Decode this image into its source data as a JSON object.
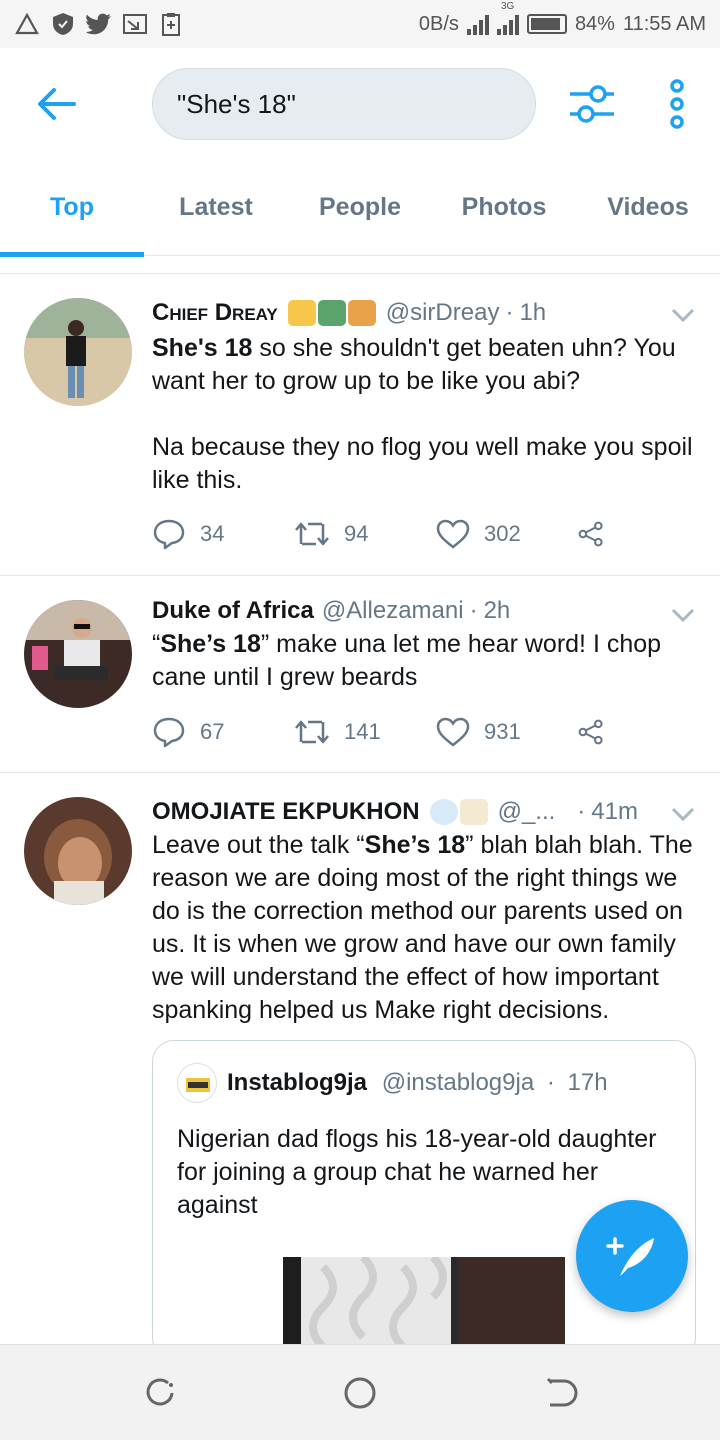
{
  "status_bar": {
    "net_speed": "0B/s",
    "network_type": "3G",
    "battery": "84%",
    "time": "11:55 AM",
    "icons": [
      "alert-triangle-icon",
      "shield-icon",
      "twitter-icon",
      "cast-icon",
      "clipboard-icon",
      "signal-icon",
      "signal-3g-icon",
      "battery-icon"
    ]
  },
  "header": {
    "search_query": "\"She's 18\"",
    "icons": [
      "back-arrow-icon",
      "filter-icon",
      "more-vertical-icon"
    ]
  },
  "tabs": [
    {
      "label": "Top",
      "active": true
    },
    {
      "label": "Latest",
      "active": false
    },
    {
      "label": "People",
      "active": false
    },
    {
      "label": "Photos",
      "active": false
    },
    {
      "label": "Videos",
      "active": false
    }
  ],
  "tweets": [
    {
      "name": "Chief Dreay",
      "handle": "@sirDreay",
      "time": "1h",
      "text_bold": "She's 18",
      "text_rest": " so she shouldn't get beaten uhn? You want her to grow up to be like you abi?",
      "text_para2": "Na because they no flog you well make you spoil like this.",
      "replies": "34",
      "retweets": "94",
      "likes": "302"
    },
    {
      "name": "Duke of Africa",
      "handle": "@Allezamani",
      "time": "2h",
      "text_open": "“",
      "text_bold": "She’s 18",
      "text_rest": "” make una let me hear word! I chop cane until I grew beards",
      "replies": "67",
      "retweets": "141",
      "likes": "931"
    },
    {
      "name": "OMOJIATE EKPUKHON",
      "handle": "@_...",
      "time": "41m",
      "text_pre": "Leave out the talk “",
      "text_bold": "She’s 18",
      "text_rest": "” blah blah blah. The reason we are doing most of the right things we do is the correction method our parents used on us. It is when we grow and have our own family we will understand the effect of how important spanking helped us Make right decisions.",
      "quoted": {
        "name": "Instablog9ja",
        "handle": "@instablog9ja",
        "time": "17h",
        "text": "Nigerian dad flogs his 18-year-old daughter for joining a group chat he warned her against"
      }
    }
  ],
  "colors": {
    "accent": "#1da1f2",
    "secondary_text": "#657786",
    "divider": "#e1e8ed"
  }
}
